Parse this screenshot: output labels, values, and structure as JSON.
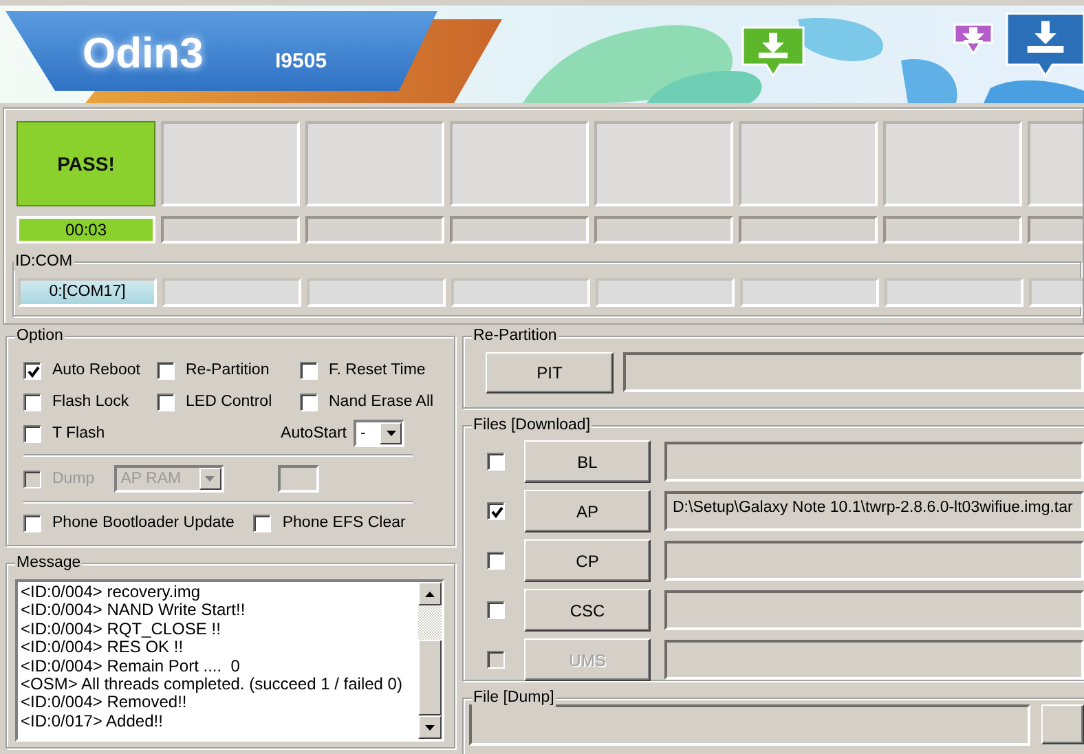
{
  "header": {
    "title": "Odin3",
    "model": "I9505"
  },
  "ports": [
    {
      "status": "PASS!",
      "color": "#8ad12e",
      "time": "00:03",
      "id_com": "0:[COM17]"
    }
  ],
  "id_com_title": "ID:COM",
  "option": {
    "title": "Option",
    "checks": [
      {
        "label": "Auto Reboot",
        "checked": true
      },
      {
        "label": "Re-Partition",
        "checked": false
      },
      {
        "label": "F. Reset Time",
        "checked": false
      },
      {
        "label": "Flash Lock",
        "checked": false
      },
      {
        "label": "LED Control",
        "checked": false
      },
      {
        "label": "Nand Erase All",
        "checked": false
      }
    ],
    "t_flash": {
      "label": "T Flash",
      "checked": false
    },
    "autostart": {
      "label": "AutoStart",
      "value": "-"
    },
    "dump": {
      "label": "Dump",
      "checked": false,
      "disabled": true,
      "value": "AP RAM"
    },
    "phone_checks": [
      {
        "label": "Phone Bootloader Update",
        "checked": false
      },
      {
        "label": "Phone EFS Clear",
        "checked": false
      }
    ]
  },
  "message": {
    "title": "Message",
    "lines": [
      "<ID:0/004> recovery.img",
      "<ID:0/004> NAND Write Start!!",
      "<ID:0/004> RQT_CLOSE !!",
      "<ID:0/004> RES OK !!",
      "<ID:0/004> Remain Port ....  0",
      "<OSM> All threads completed. (succeed 1 / failed 0)",
      "<ID:0/004> Removed!!",
      "<ID:0/017> Added!!"
    ]
  },
  "repartition": {
    "title": "Re-Partition",
    "button": "PIT"
  },
  "files": {
    "title": "Files [Download]",
    "rows": [
      {
        "button": "BL",
        "checked": false,
        "disabled": false
      },
      {
        "button": "AP",
        "checked": true,
        "disabled": false,
        "value": "D:\\Setup\\Galaxy Note 10.1\\twrp-2.8.6.0-lt03wifiue.img.tar"
      },
      {
        "button": "CP",
        "checked": false,
        "disabled": false
      },
      {
        "button": "CSC",
        "checked": false,
        "disabled": false
      },
      {
        "button": "UMS",
        "checked": false,
        "disabled": true
      }
    ]
  },
  "file_dump": {
    "title": "File [Dump]"
  }
}
